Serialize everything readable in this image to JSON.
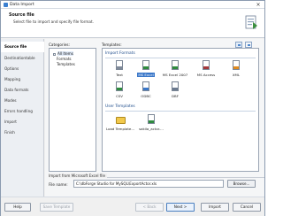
{
  "window": {
    "title": "Data Import",
    "close_glyph": "×"
  },
  "header": {
    "title": "Source file",
    "subtitle": "Select file to import and specify file format."
  },
  "nav": {
    "items": [
      {
        "label": "Source file",
        "active": true
      },
      {
        "label": "Destinationtable",
        "active": false
      },
      {
        "label": "Options",
        "active": false
      },
      {
        "label": "Mapping",
        "active": false
      },
      {
        "label": "Data formats",
        "active": false
      },
      {
        "label": "Modes",
        "active": false
      },
      {
        "label": "Errors handling",
        "active": false
      },
      {
        "label": "Import",
        "active": false
      },
      {
        "label": "Finish",
        "active": false
      }
    ]
  },
  "categories": {
    "label": "Categories:",
    "items": [
      "All Items",
      "Formats",
      "Templates"
    ]
  },
  "templates": {
    "label": "Templates:",
    "import_formats_title": "Import Formats",
    "formats": [
      {
        "caption": "Text",
        "icon": "text-file-icon",
        "color": "#7f8a99"
      },
      {
        "caption": "MS Excel",
        "icon": "excel-file-icon",
        "color": "#2e8b3e"
      },
      {
        "caption": "MS Excel 2007",
        "icon": "excel-2007-file-icon",
        "color": "#2e8b3e"
      },
      {
        "caption": "MS Access",
        "icon": "access-file-icon",
        "color": "#a4373a"
      },
      {
        "caption": "XML",
        "icon": "xml-file-icon",
        "color": "#e08a1e"
      },
      {
        "caption": "CSV",
        "icon": "csv-file-icon",
        "color": "#2e8b3e"
      },
      {
        "caption": "ODBC",
        "icon": "odbc-icon",
        "color": "#3a77c9"
      },
      {
        "caption": "DBF",
        "icon": "dbf-file-icon",
        "color": "#6b7a8f"
      }
    ],
    "user_templates_title": "User Templates",
    "user_templates": [
      {
        "caption": "Load Template...",
        "icon": "folder-icon"
      },
      {
        "caption": "sakila_actor....",
        "icon": "template-file-icon"
      }
    ]
  },
  "import_from": {
    "caption": "Import from Microsoft Excel file",
    "file_label": "File name:",
    "file_value": "C:\\dbForge Studio for MySQL\\ExportActor.xls",
    "browse_label": "Browse..."
  },
  "footer": {
    "help": "Help",
    "save_template": "Save Template",
    "back": "< Back",
    "next": "Next >",
    "import": "Import",
    "cancel": "Cancel"
  },
  "colors": {
    "accent": "#3a77c9",
    "group_title": "#1f4d8c"
  }
}
